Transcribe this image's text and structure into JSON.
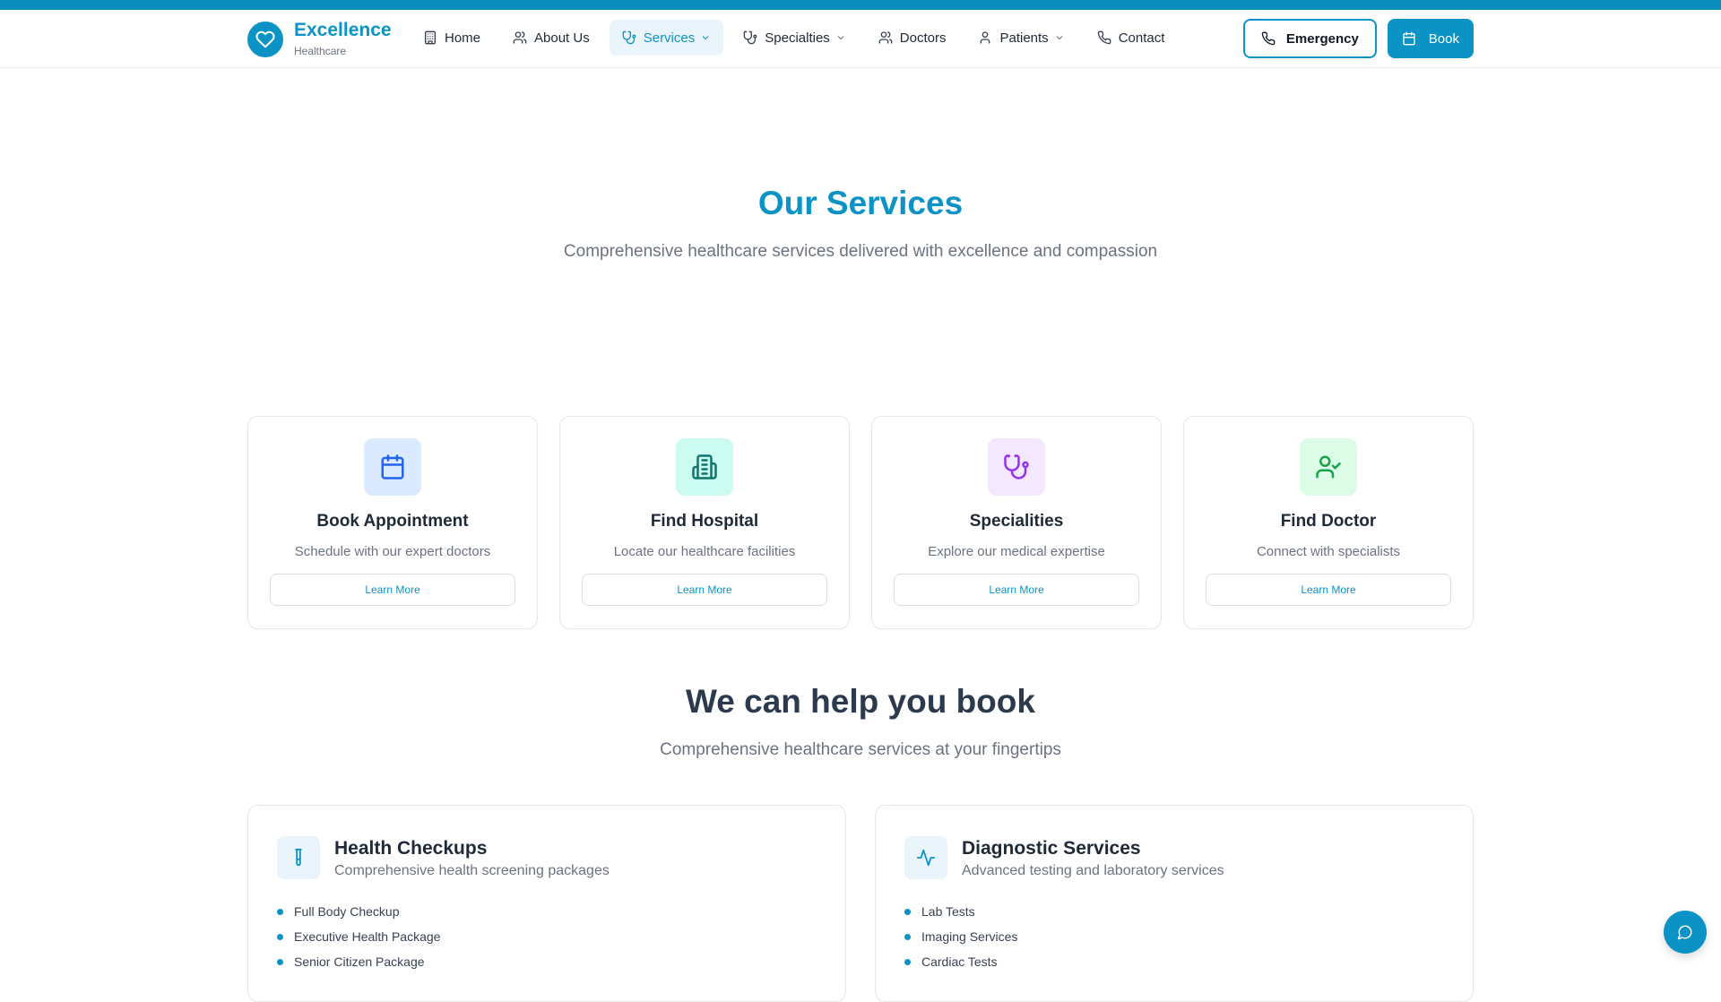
{
  "brand": {
    "name": "Excellence",
    "subtitle": "Healthcare"
  },
  "nav": {
    "items": [
      {
        "label": "Home",
        "icon": "building-icon"
      },
      {
        "label": "About Us",
        "icon": "users-icon"
      },
      {
        "label": "Services",
        "icon": "stethoscope-icon",
        "active": true,
        "has_dropdown": true
      },
      {
        "label": "Specialties",
        "icon": "stethoscope-icon",
        "has_dropdown": true
      },
      {
        "label": "Doctors",
        "icon": "users-icon"
      },
      {
        "label": "Patients",
        "icon": "user-icon",
        "has_dropdown": true
      },
      {
        "label": "Contact",
        "icon": "phone-icon"
      }
    ]
  },
  "actions": {
    "emergency_label": "Emergency",
    "book_label": "Book"
  },
  "hero": {
    "title": "Our Services",
    "subtitle": "Comprehensive healthcare services delivered with excellence and compassion"
  },
  "cards": [
    {
      "title": "Book Appointment",
      "desc": "Schedule with our expert doctors",
      "button": "Learn More",
      "icon": "calendar-icon",
      "icon_bg": "#dbeafe",
      "icon_color": "#2563eb"
    },
    {
      "title": "Find Hospital",
      "desc": "Locate our healthcare facilities",
      "button": "Learn More",
      "icon": "hospital-icon",
      "icon_bg": "#ccfbf1",
      "icon_color": "#0f766e"
    },
    {
      "title": "Specialities",
      "desc": "Explore our medical expertise",
      "button": "Learn More",
      "icon": "stethoscope-icon",
      "icon_bg": "#f3e8ff",
      "icon_color": "#9333ea"
    },
    {
      "title": "Find Doctor",
      "desc": "Connect with specialists",
      "button": "Learn More",
      "icon": "user-check-icon",
      "icon_bg": "#dcfce7",
      "icon_color": "#16a34a"
    }
  ],
  "help": {
    "title": "We can help you book",
    "subtitle": "Comprehensive healthcare services at your fingertips"
  },
  "panels": [
    {
      "title": "Health Checkups",
      "subtitle": "Comprehensive health screening packages",
      "icon": "test-tube-icon",
      "items": [
        "Full Body Checkup",
        "Executive Health Package",
        "Senior Citizen Package"
      ]
    },
    {
      "title": "Diagnostic Services",
      "subtitle": "Advanced testing and laboratory services",
      "icon": "activity-icon",
      "items": [
        "Lab Tests",
        "Imaging Services",
        "Cardiac Tests"
      ]
    }
  ],
  "colors": {
    "primary": "#0b93c5",
    "topbar": "#0a8fbd",
    "text": "#1f2937",
    "muted": "#6b7280"
  }
}
